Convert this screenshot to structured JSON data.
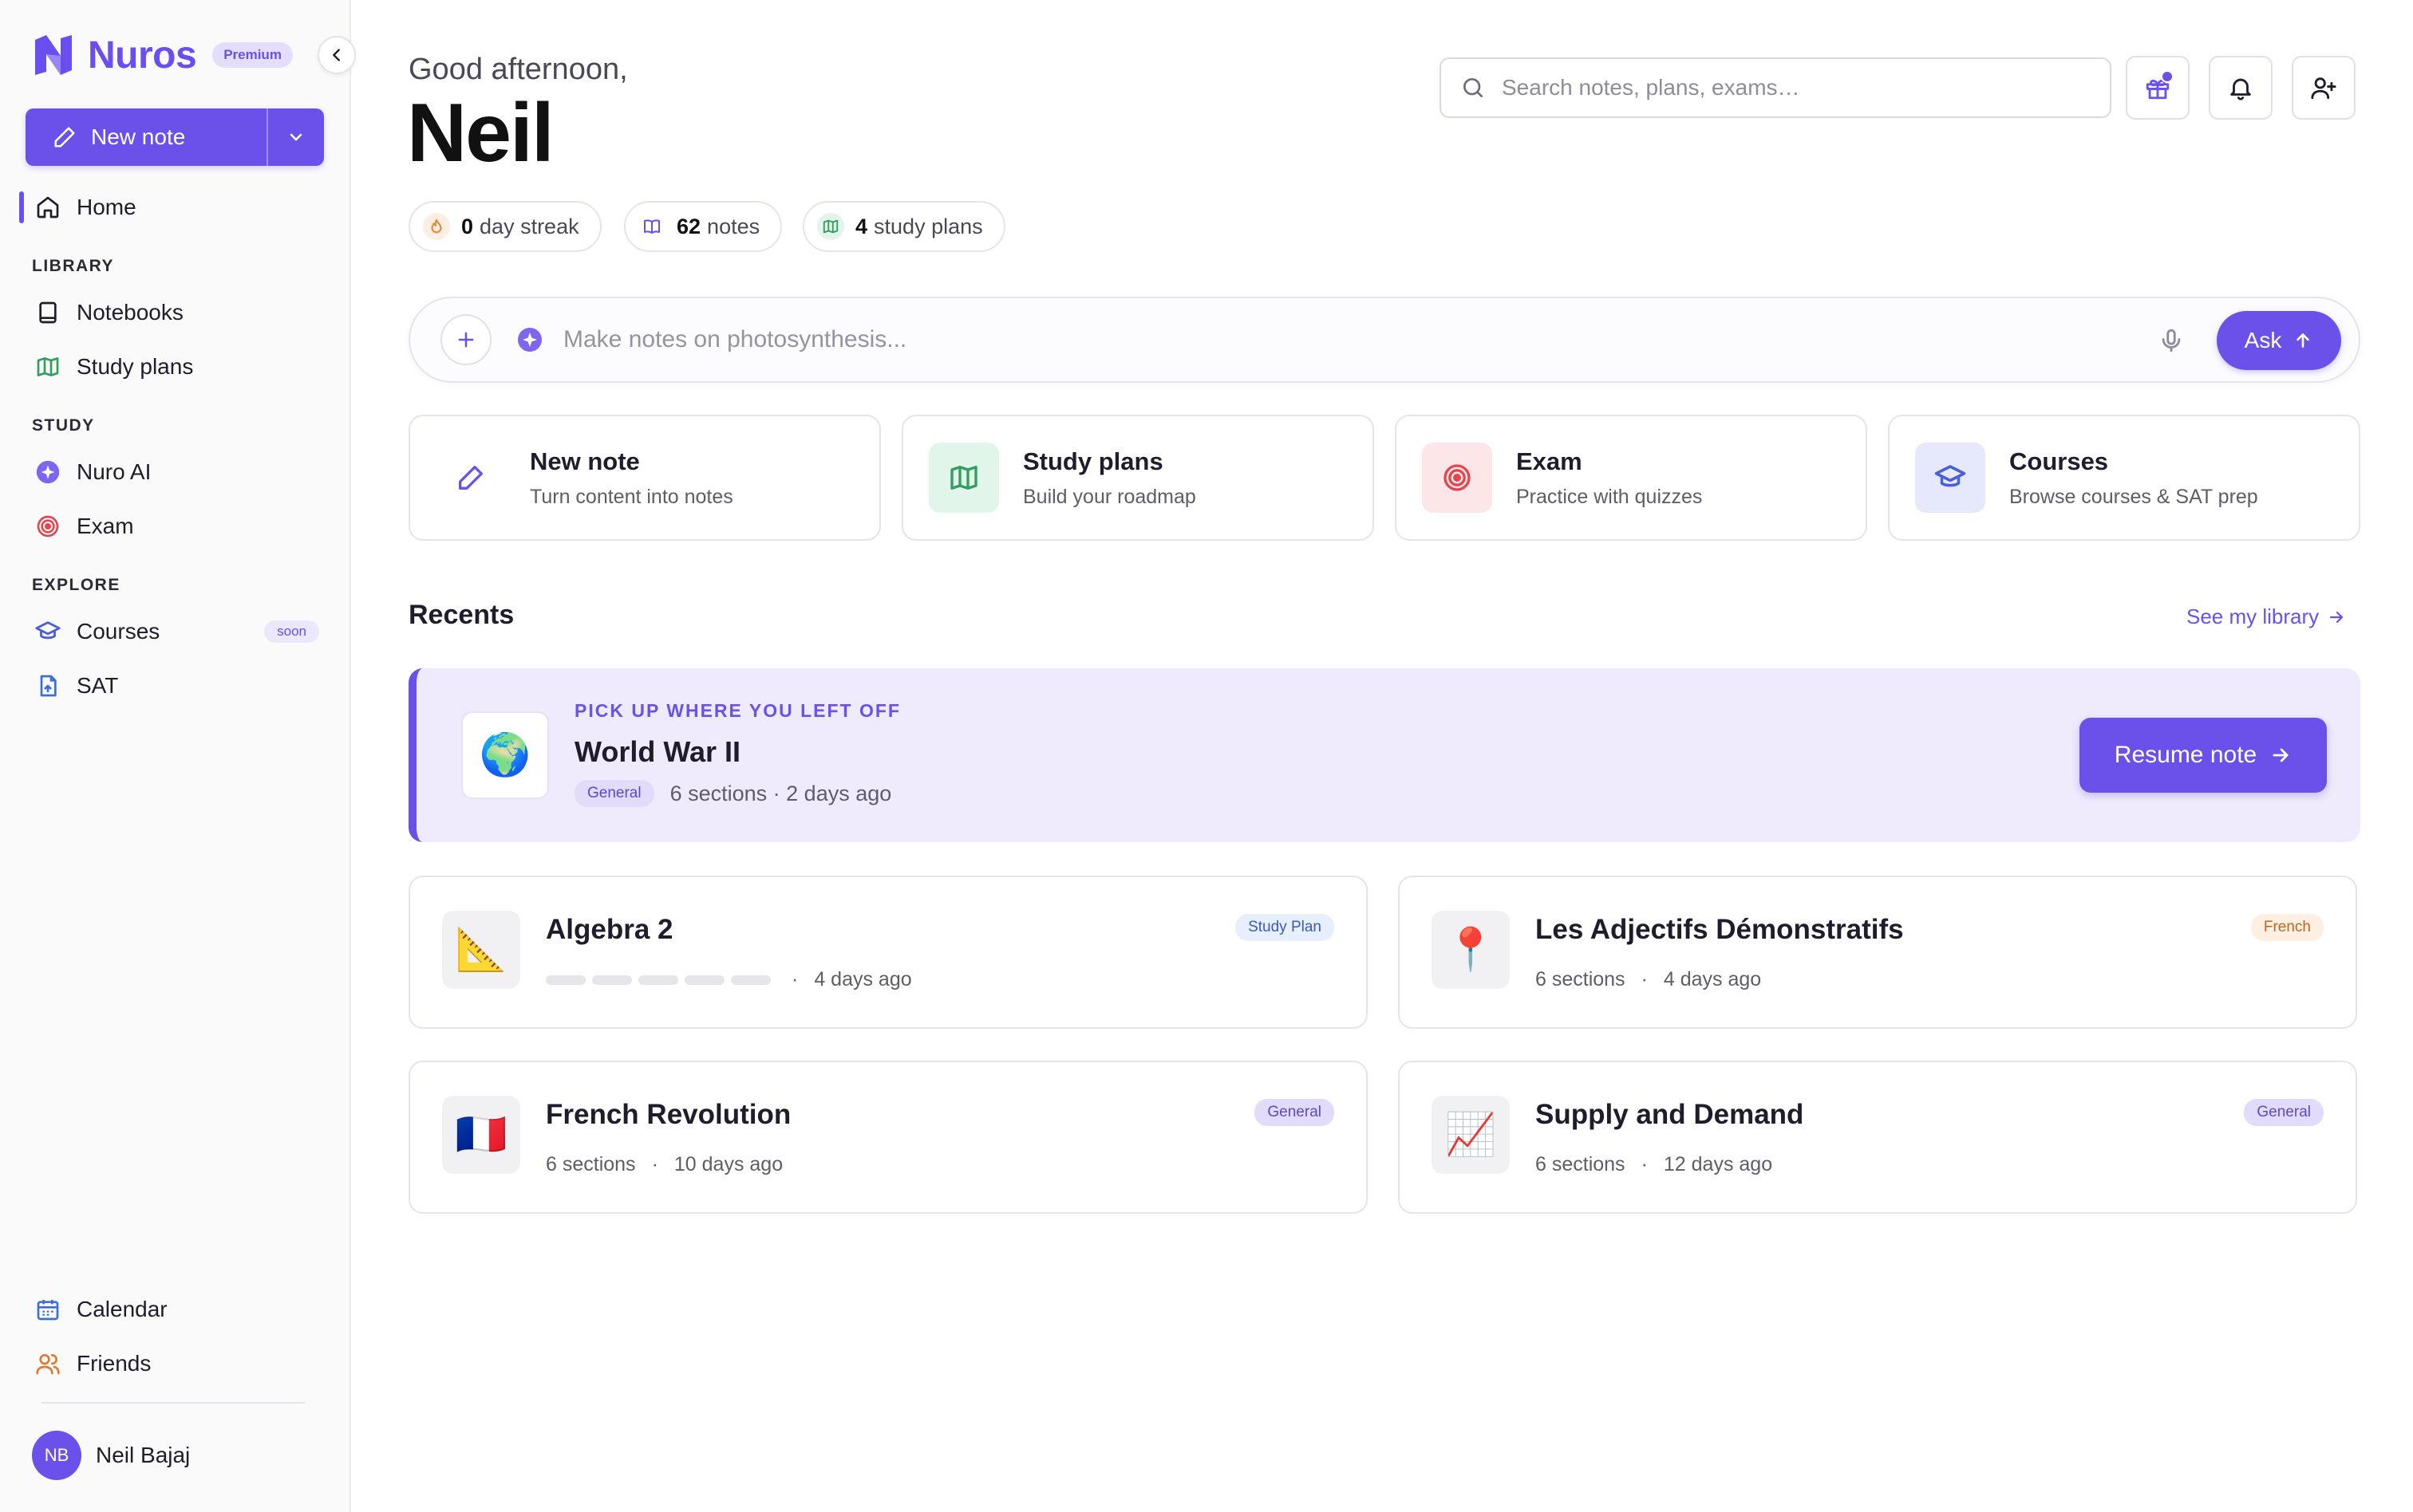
{
  "sidebar": {
    "brand": "Nuros",
    "plan_badge": "Premium",
    "new_note_label": "New note",
    "home": "Home",
    "library_label": "LIBRARY",
    "notebooks": "Notebooks",
    "study_plans": "Study plans",
    "study_label": "STUDY",
    "nuro_ai": "Nuro AI",
    "exam": "Exam",
    "explore_label": "EXPLORE",
    "courses": "Courses",
    "courses_badge": "soon",
    "sat": "SAT",
    "calendar": "Calendar",
    "friends": "Friends",
    "user_initials": "NB",
    "user_name": "Neil Bajaj"
  },
  "header": {
    "greeting": "Good afternoon,",
    "name": "Neil",
    "search_placeholder": "Search notes, plans, exams…"
  },
  "stats": {
    "streak_value": "0",
    "streak_label": "day streak",
    "notes_value": "62",
    "notes_label": "notes",
    "plans_value": "4",
    "plans_label": "study plans"
  },
  "ask": {
    "placeholder": "Make notes on photosynthesis...",
    "button": "Ask"
  },
  "quick_actions": [
    {
      "title": "New note",
      "subtitle": "Turn content into notes"
    },
    {
      "title": "Study plans",
      "subtitle": "Build your roadmap"
    },
    {
      "title": "Exam",
      "subtitle": "Practice with quizzes"
    },
    {
      "title": "Courses",
      "subtitle": "Browse courses & SAT prep"
    }
  ],
  "recents": {
    "title": "Recents",
    "see_library": "See my library",
    "resume": {
      "eyebrow": "PICK UP WHERE YOU LEFT OFF",
      "emoji": "🌍",
      "title": "World War II",
      "tag": "General",
      "meta": "6 sections · 2 days ago",
      "button": "Resume note"
    },
    "items": [
      {
        "emoji": "📐",
        "title": "Algebra 2",
        "tag": "Study Plan",
        "sections": "",
        "time": "4 days ago",
        "progress": 0
      },
      {
        "emoji": "📍",
        "title": "Les Adjectifs Démonstratifs",
        "tag": "French",
        "sections": "6 sections",
        "time": "4 days ago"
      },
      {
        "emoji": "🇫🇷",
        "title": "French Revolution",
        "tag": "General",
        "sections": "6 sections",
        "time": "10 days ago"
      },
      {
        "emoji": "📈",
        "title": "Supply and Demand",
        "tag": "General",
        "sections": "6 sections",
        "time": "12 days ago"
      }
    ]
  },
  "colors": {
    "accent": "#6b51ea",
    "accent_light": "#efebfd"
  },
  "icons": [
    "nuros-logo-icon",
    "chevron-left-icon",
    "pencil-icon",
    "chevron-down-icon",
    "home-icon",
    "book-icon",
    "map-icon",
    "sparkle-icon",
    "target-icon",
    "graduation-cap-icon",
    "sat-icon",
    "calendar-icon",
    "users-icon",
    "search-icon",
    "gift-icon",
    "bell-icon",
    "user-plus-icon",
    "flame-icon",
    "plus-icon",
    "mic-icon",
    "arrow-up-icon",
    "arrow-right-icon"
  ]
}
